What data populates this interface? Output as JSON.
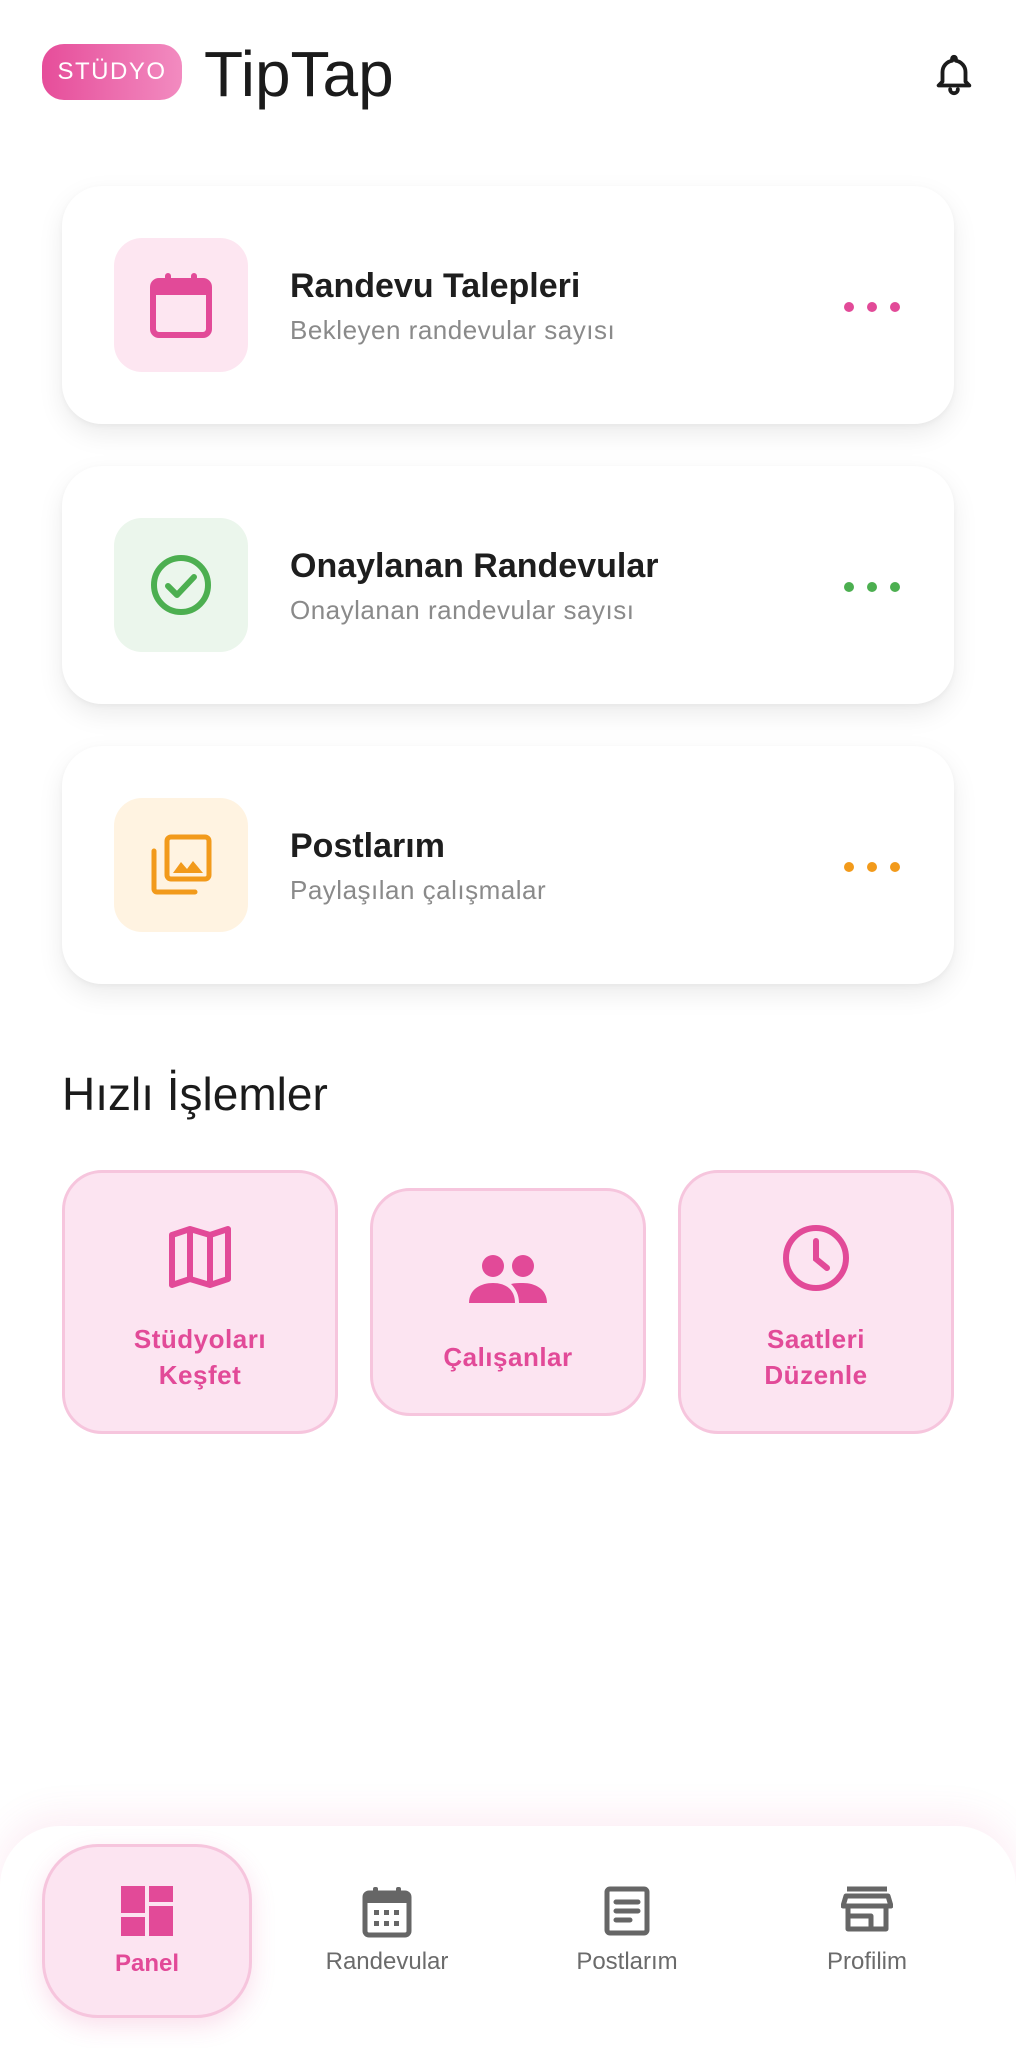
{
  "header": {
    "badge": "STÜDYO",
    "app_title": "TipTap",
    "notifications_icon": "bell-icon"
  },
  "cards": [
    {
      "title": "Randevu Talepleri",
      "subtitle": "Bekleyen randevular sayısı",
      "icon": "calendar-icon",
      "accent": "#e24a98",
      "icon_bg": "#fde6f1"
    },
    {
      "title": "Onaylanan Randevular",
      "subtitle": "Onaylanan randevular sayısı",
      "icon": "check-circle-icon",
      "accent": "#4caf50",
      "icon_bg": "#ebf6ec"
    },
    {
      "title": "Postlarım",
      "subtitle": "Paylaşılan çalışmalar",
      "icon": "photo-library-icon",
      "accent": "#f29a1b",
      "icon_bg": "#fff3e1"
    }
  ],
  "quick_actions": {
    "title": "Hızlı İşlemler",
    "items": [
      {
        "label_line1": "Stüdyoları",
        "label_line2": "Keşfet",
        "icon": "map-icon"
      },
      {
        "label_line1": "Çalışanlar",
        "label_line2": "",
        "icon": "people-icon"
      },
      {
        "label_line1": "Saatleri",
        "label_line2": "Düzenle",
        "icon": "clock-icon"
      }
    ]
  },
  "bottom_nav": {
    "items": [
      {
        "label": "Panel",
        "icon": "dashboard-icon",
        "active": true
      },
      {
        "label": "Randevular",
        "icon": "calendar-month-icon",
        "active": false
      },
      {
        "label": "Postlarım",
        "icon": "article-icon",
        "active": false
      },
      {
        "label": "Profilim",
        "icon": "store-icon",
        "active": false
      }
    ]
  },
  "colors": {
    "brand_pink": "#e24a98",
    "pink_light": "#fce4f1",
    "green": "#4caf50",
    "orange": "#f29a1b",
    "text_dark": "#1e1e1e",
    "text_muted": "#8a8a8a"
  }
}
